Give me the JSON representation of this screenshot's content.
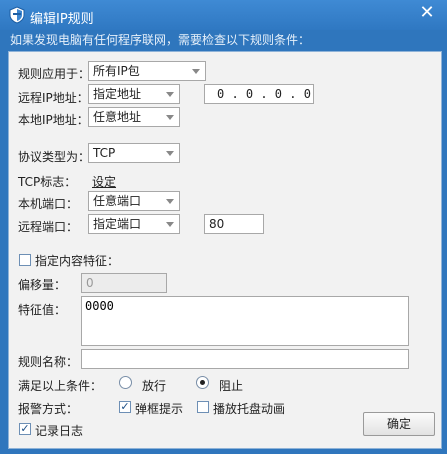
{
  "window": {
    "title": "编辑IP规则",
    "subtitle": "如果发现电脑有任何程序联网，需要检查以下规则条件："
  },
  "form": {
    "apply_to": {
      "label": "规则应用于：",
      "value": "所有IP包"
    },
    "remote_ip": {
      "label": "远程IP地址：",
      "mode": "指定地址",
      "value": "0 . 0 . 0 . 0"
    },
    "local_ip": {
      "label": "本地IP地址：",
      "value": "任意地址"
    },
    "protocol": {
      "label": "协议类型为：",
      "value": "TCP"
    },
    "tcp_flags": {
      "label": "TCP标志：",
      "link": "设定"
    },
    "local_port": {
      "label": "本机端口：",
      "value": "任意端口"
    },
    "remote_port": {
      "label": "远程端口：",
      "mode": "指定端口",
      "value": "80"
    },
    "content_feature": {
      "label": "指定内容特征：",
      "checked": false
    },
    "offset": {
      "label": "偏移量：",
      "value": "0"
    },
    "feature_value": {
      "label": "特征值：",
      "value": "0000"
    },
    "rule_name": {
      "label": "规则名称：",
      "value": ""
    },
    "action": {
      "label": "满足以上条件：",
      "allow": "放行",
      "block": "阻止",
      "selected": "阻止"
    },
    "alert": {
      "label": "报警方式：",
      "popup": "弹框提示",
      "popup_checked": true,
      "tray": "播放托盘动画",
      "tray_checked": false
    },
    "log": {
      "label": "记录日志",
      "checked": true
    }
  },
  "buttons": {
    "ok": "确定"
  }
}
